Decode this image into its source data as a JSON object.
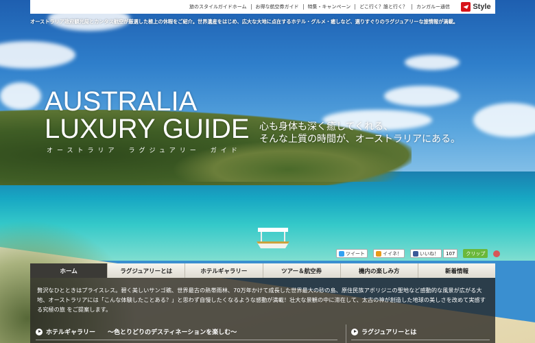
{
  "topnav": {
    "items": [
      "旅のスタイルガイドホーム",
      "お得な航空券ガイド",
      "特集・キャンペーン",
      "どこ行く？誰と行く？",
      "カンガルー通信"
    ],
    "brand": "Style"
  },
  "tagline": "オーストラリア政府観光局とカンタス航空が厳選した極上の休暇をご紹介。世界遺産をはじめ、広大な大地に点在するホテル・グルメ・癒しなど、選りすぐりのラグジュアリーな旅情報が満載。",
  "hero": {
    "title_line1": "AUSTRALIA",
    "title_line2": "LUXURY GUIDE",
    "title_kana": "オーストラリア　ラグジュアリー　ガイド",
    "catch_line1": "心も身体も深く癒してくれる、",
    "catch_line2": "そんな上質の時間が、オーストラリアにある。"
  },
  "social": {
    "tweet": "ツイート",
    "mixi": "イイネ！",
    "facebook": "いいね！",
    "facebook_count": "107",
    "clip": "クリップ"
  },
  "tabs": [
    {
      "label": "ホーム",
      "active": true
    },
    {
      "label": "ラグジュアリーとは",
      "active": false
    },
    {
      "label": "ホテルギャラリー",
      "active": false
    },
    {
      "label": "ツアー＆航空券",
      "active": false
    },
    {
      "label": "機内の楽しみ方",
      "active": false
    },
    {
      "label": "新着情報",
      "active": false
    }
  ],
  "intro": "贅沢なひとときはプライスレス。碧く美しいサンゴ礁、世界最古の熱帯雨林、70万年かけて成長した世界最大の砂の島、原住民族アボリジニの聖地など感動的な風景が広がる大地、オーストラリアには「こんな体験したことある？」と思わず自慢したくなるような感動が満載！壮大な景観の中に滞在して、太古の神が創造した地球の美しさを改めて実感する究極の旅 をご提案します。",
  "sections": {
    "left": "ホテルギャラリー　　〜色とりどりのデスティネーションを楽しむ〜",
    "right": "ラグジュアリーとは"
  }
}
